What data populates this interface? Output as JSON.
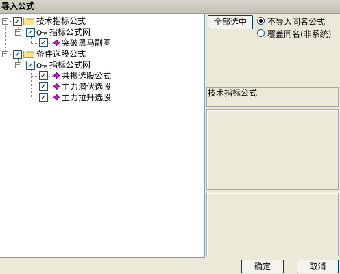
{
  "window": {
    "title": "导入公式"
  },
  "tree": {
    "group1": {
      "label": "技术指标公式",
      "subgroup": {
        "label": "指标公式网",
        "items": [
          "突破黑马副图"
        ]
      }
    },
    "group2": {
      "label": "条件选股公式",
      "subgroup": {
        "label": "指标公式网",
        "items": [
          "共振选股公式",
          "主力潜伏选股",
          "主力拉升选股"
        ]
      }
    }
  },
  "options": {
    "select_all_label": "全部选中",
    "radio_no_import": "不导入同名公式",
    "radio_overwrite": "覆盖同名(非系统)",
    "selected": "no_import"
  },
  "description": {
    "title": "技术指标公式"
  },
  "footer": {
    "ok_label": "确定",
    "cancel_label": "取消"
  }
}
